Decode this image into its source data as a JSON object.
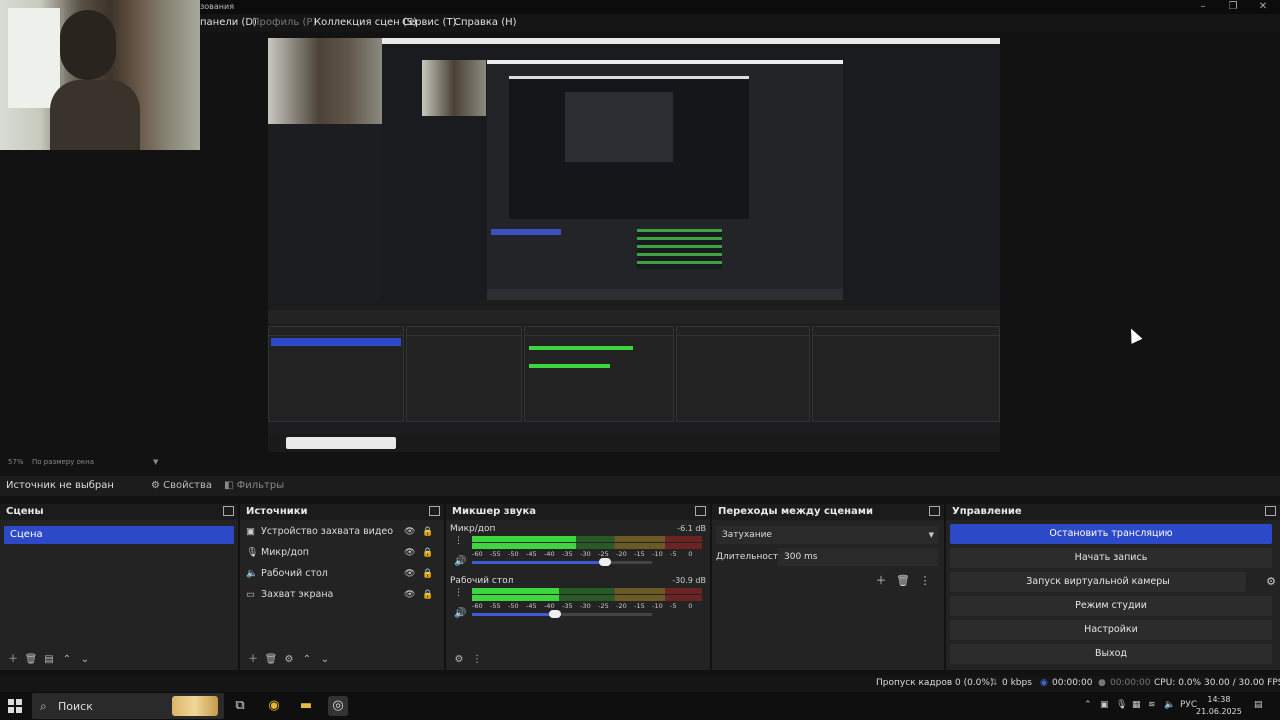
{
  "window": {
    "title_fragment": "зования"
  },
  "menu": {
    "items": [
      {
        "label": "панели (D)",
        "dim": false
      },
      {
        "label": "Профиль (P)",
        "dim": true
      },
      {
        "label": "Коллекция сцен (S)",
        "dim": false
      },
      {
        "label": "Сервис (T)",
        "dim": false
      },
      {
        "label": "Справка (H)",
        "dim": false
      }
    ]
  },
  "zoom": {
    "level": "57%",
    "mode": "По размеру окна"
  },
  "properties_bar": {
    "no_source": "Источник не выбран",
    "properties": "Свойства",
    "filters": "Фильтры"
  },
  "scenes": {
    "title": "Сцены",
    "items": [
      "Сцена"
    ]
  },
  "sources": {
    "title": "Источники",
    "items": [
      {
        "label": "Устройство захвата видео",
        "icon": "camera-icon"
      },
      {
        "label": "Микр/доп",
        "icon": "microphone-icon"
      },
      {
        "label": "Рабочий стол",
        "icon": "speaker-icon"
      },
      {
        "label": "Захват экрана",
        "icon": "monitor-icon"
      }
    ]
  },
  "mixer": {
    "title": "Микшер звука",
    "channels": [
      {
        "name": "Микр/доп",
        "db": "-6.1 dB",
        "level": 0.45,
        "volume": 0.74
      },
      {
        "name": "Рабочий стол",
        "db": "-30.9 dB",
        "level": 0.38,
        "volume": 0.46
      }
    ],
    "ticks": [
      "-60",
      "-55",
      "-50",
      "-45",
      "-40",
      "-35",
      "-30",
      "-25",
      "-20",
      "-15",
      "-10",
      "-5",
      "0"
    ]
  },
  "transitions": {
    "title": "Переходы между сценами",
    "selected": "Затухание",
    "duration_label": "Длительность",
    "duration_value": "300 ms"
  },
  "controls": {
    "title": "Управление",
    "buttons": [
      "Остановить трансляцию",
      "Начать запись",
      "Запуск виртуальной камеры",
      "Режим студии",
      "Настройки",
      "Выход"
    ]
  },
  "status": {
    "dropped": "Пропуск кадров 0 (0.0%)",
    "bitrate": "0 kbps",
    "stream_time": "00:00:00",
    "rec_time": "00:00:00",
    "cpu": "CPU: 0.0%",
    "fps": "30.00 / 30.00 FPS"
  },
  "taskbar": {
    "search_placeholder": "Поиск",
    "lang": "РУС",
    "time": "14:38",
    "date": "21.06.2025"
  },
  "colors": {
    "accent": "#2c49c8",
    "background": "#121212",
    "panel": "#232323"
  }
}
